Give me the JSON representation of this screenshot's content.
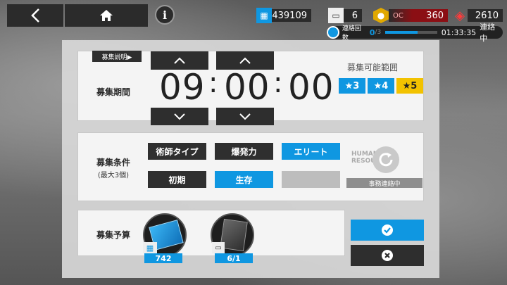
{
  "resources": {
    "permit_value": "439109",
    "plan_value": "6",
    "ocean_value": "360",
    "orig_value": "2610",
    "ocean_tag": "OC"
  },
  "link": {
    "label": "連絡回数",
    "count": "0",
    "sep": "/3",
    "time": "01:33:35",
    "status": "連絡中",
    "progress": 0.62
  },
  "info_label": "i",
  "recruit": {
    "desc_button": "募集説明▶",
    "time_label": "募集期間",
    "hours": "09",
    "minutes": "00",
    "seconds": "00",
    "colon": ":",
    "range_title": "募集可能範囲",
    "stars": [
      "★3",
      "★4",
      "★5"
    ],
    "condition_label": "募集条件",
    "condition_sub": "(最大3個)",
    "tags": [
      "術師タイプ",
      "爆発力",
      "エリート",
      "初期",
      "生存",
      ""
    ],
    "refresh_label": "事務連絡中",
    "hr_text": "HUMAN RESOURCES",
    "budget_label": "募集予算",
    "items": [
      "742",
      "6/1"
    ]
  },
  "colors": {
    "accent_blue": "#0f97e1",
    "star5_yellow": "#f2c200",
    "dark": "#2e2e2e"
  }
}
